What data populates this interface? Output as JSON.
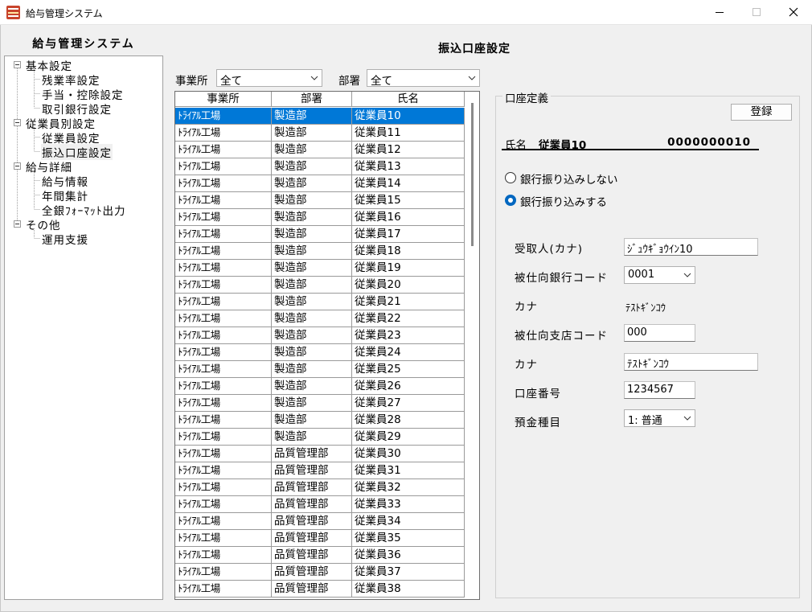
{
  "window": {
    "title": "給与管理システム",
    "minimize_icon": "minimize-icon",
    "maximize_icon": "maximize-icon",
    "close_icon": "close-icon"
  },
  "sidebar": {
    "header": "給与管理システム",
    "groups": [
      {
        "label": "基本設定",
        "items": [
          "残業率設定",
          "手当・控除設定",
          "取引銀行設定"
        ]
      },
      {
        "label": "従業員別設定",
        "items": [
          "従業員設定",
          "振込口座設定"
        ]
      },
      {
        "label": "給与詳細",
        "items": [
          "給与情報",
          "年間集計",
          "全銀ﾌｫｰﾏｯﾄ出力"
        ]
      },
      {
        "label": "その他",
        "items": [
          "運用支援"
        ]
      }
    ],
    "selected": "振込口座設定"
  },
  "main": {
    "title": "振込口座設定",
    "filters": {
      "office_label": "事業所",
      "office_value": "全て",
      "dept_label": "部署",
      "dept_value": "全て"
    },
    "table": {
      "columns": [
        "事業所",
        "部署",
        "氏名"
      ],
      "selected_index": 0,
      "rows": [
        [
          "ﾄﾗｲｱﾙ工場",
          "製造部",
          "従業員10"
        ],
        [
          "ﾄﾗｲｱﾙ工場",
          "製造部",
          "従業員11"
        ],
        [
          "ﾄﾗｲｱﾙ工場",
          "製造部",
          "従業員12"
        ],
        [
          "ﾄﾗｲｱﾙ工場",
          "製造部",
          "従業員13"
        ],
        [
          "ﾄﾗｲｱﾙ工場",
          "製造部",
          "従業員14"
        ],
        [
          "ﾄﾗｲｱﾙ工場",
          "製造部",
          "従業員15"
        ],
        [
          "ﾄﾗｲｱﾙ工場",
          "製造部",
          "従業員16"
        ],
        [
          "ﾄﾗｲｱﾙ工場",
          "製造部",
          "従業員17"
        ],
        [
          "ﾄﾗｲｱﾙ工場",
          "製造部",
          "従業員18"
        ],
        [
          "ﾄﾗｲｱﾙ工場",
          "製造部",
          "従業員19"
        ],
        [
          "ﾄﾗｲｱﾙ工場",
          "製造部",
          "従業員20"
        ],
        [
          "ﾄﾗｲｱﾙ工場",
          "製造部",
          "従業員21"
        ],
        [
          "ﾄﾗｲｱﾙ工場",
          "製造部",
          "従業員22"
        ],
        [
          "ﾄﾗｲｱﾙ工場",
          "製造部",
          "従業員23"
        ],
        [
          "ﾄﾗｲｱﾙ工場",
          "製造部",
          "従業員24"
        ],
        [
          "ﾄﾗｲｱﾙ工場",
          "製造部",
          "従業員25"
        ],
        [
          "ﾄﾗｲｱﾙ工場",
          "製造部",
          "従業員26"
        ],
        [
          "ﾄﾗｲｱﾙ工場",
          "製造部",
          "従業員27"
        ],
        [
          "ﾄﾗｲｱﾙ工場",
          "製造部",
          "従業員28"
        ],
        [
          "ﾄﾗｲｱﾙ工場",
          "製造部",
          "従業員29"
        ],
        [
          "ﾄﾗｲｱﾙ工場",
          "品質管理部",
          "従業員30"
        ],
        [
          "ﾄﾗｲｱﾙ工場",
          "品質管理部",
          "従業員31"
        ],
        [
          "ﾄﾗｲｱﾙ工場",
          "品質管理部",
          "従業員32"
        ],
        [
          "ﾄﾗｲｱﾙ工場",
          "品質管理部",
          "従業員33"
        ],
        [
          "ﾄﾗｲｱﾙ工場",
          "品質管理部",
          "従業員34"
        ],
        [
          "ﾄﾗｲｱﾙ工場",
          "品質管理部",
          "従業員35"
        ],
        [
          "ﾄﾗｲｱﾙ工場",
          "品質管理部",
          "従業員36"
        ],
        [
          "ﾄﾗｲｱﾙ工場",
          "品質管理部",
          "従業員37"
        ],
        [
          "ﾄﾗｲｱﾙ工場",
          "品質管理部",
          "従業員38"
        ]
      ]
    }
  },
  "account": {
    "group_label": "口座定義",
    "register_label": "登録",
    "name_label": "氏名",
    "name_value": "従業員10",
    "employee_code": "0000000010",
    "radio_no_transfer": "銀行振り込みしない",
    "radio_transfer": "銀行振り込みする",
    "transfer_enabled": true,
    "payee_kana_label": "受取人(カナ)",
    "payee_kana_value": "ｼﾞｭｳｷﾞｮｳｲﾝ10",
    "bank_code_label": "被仕向銀行コード",
    "bank_code_value": "0001",
    "bank_kana_label": "カナ",
    "bank_kana_value": "ﾃｽﾄｷﾞﾝｺｳ",
    "branch_code_label": "被仕向支店コード",
    "branch_code_value": "000",
    "branch_kana_label": "カナ",
    "branch_kana_value": "ﾃｽﾄｷﾞﾝｺｳ",
    "account_no_label": "口座番号",
    "account_no_value": "1234567",
    "deposit_type_label": "預金種目",
    "deposit_type_value": "1: 普通"
  },
  "colors": {
    "selection": "#0078d7",
    "radio_accent": "#0067c0",
    "app_icon": "#c8442c"
  }
}
